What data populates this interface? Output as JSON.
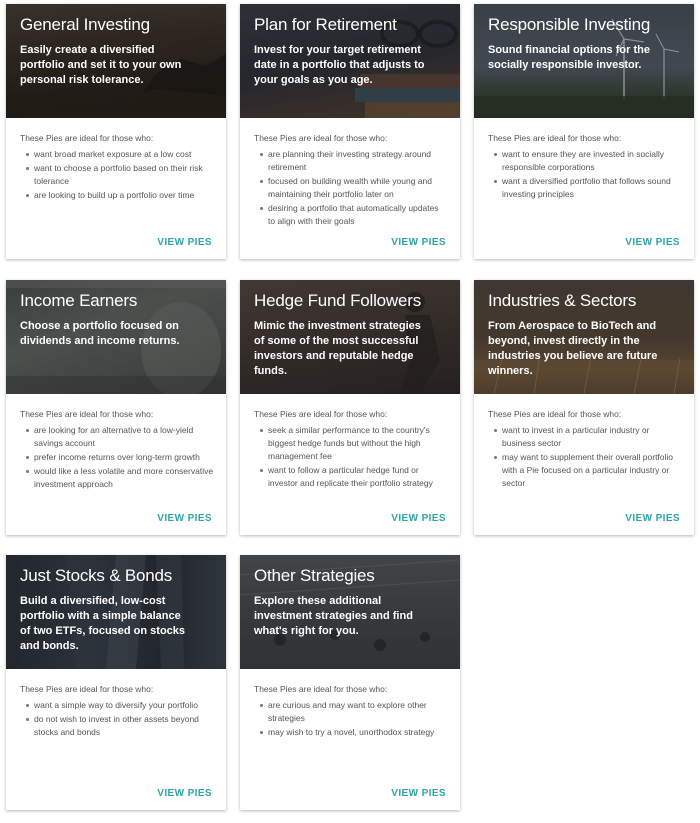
{
  "ideal_heading": "These Pies are ideal for those who:",
  "link_color": "#2ca5a6",
  "cards": [
    {
      "title": "General Investing",
      "description": "Easily create a diversified portfolio and set it to your own personal risk tolerance.",
      "bullets": [
        "want broad market exposure at a low cost",
        "want to choose a portfolio based on their risk tolerance",
        "are looking to build up a portfolio over time"
      ],
      "link": "VIEW PIES"
    },
    {
      "title": "Plan for Retirement",
      "description": "Invest for your target retirement date in a portfolio that adjusts to your goals as you age.",
      "bullets": [
        "are planning their investing strategy around retirement",
        "focused on building wealth while young and maintaining their portfolio later on",
        "desiring a portfolio that automatically updates to align with their goals"
      ],
      "link": "VIEW PIES"
    },
    {
      "title": "Responsible Investing",
      "description": "Sound financial options for the socially responsible investor.",
      "bullets": [
        "want to ensure they are invested in socially responsible corporations",
        "want a diversified portfolio that follows sound investing principles"
      ],
      "link": "VIEW PIES"
    },
    {
      "title": "Income Earners",
      "description": "Choose a portfolio focused on dividends and income returns.",
      "bullets": [
        "are looking for an alternative to a low-yield savings account",
        "prefer income returns over long-term growth",
        "would like a less volatile and more conservative investment approach"
      ],
      "link": "VIEW PIES"
    },
    {
      "title": "Hedge Fund Followers",
      "description": "Mimic the investment strategies of some of the most successful investors and reputable hedge funds.",
      "bullets": [
        "seek a similar performance to the country's biggest hedge funds but without the high management fee",
        "want to follow a particular hedge fund or investor and replicate their portfolio strategy"
      ],
      "link": "VIEW PIES"
    },
    {
      "title": "Industries & Sectors",
      "description": "From Aerospace to BioTech and beyond, invest directly in the industries you believe are future winners.",
      "bullets": [
        "want to invest in a particular industry or business sector",
        "may want to supplement their overall portfolio with a Pie focused on a particular industry or sector"
      ],
      "link": "VIEW PIES"
    },
    {
      "title": "Just Stocks & Bonds",
      "description": "Build a diversified, low-cost portfolio with a simple balance of two ETFs, focused on stocks and bonds.",
      "bullets": [
        "want a simple way to diversify your portfolio",
        "do not wish to invest in other assets beyond stocks and bonds"
      ],
      "link": "VIEW PIES"
    },
    {
      "title": "Other Strategies",
      "description": "Explore these additional investment strategies and find what's right for you.",
      "bullets": [
        "are curious and may want to explore other strategies",
        "may wish to try a novel, unorthodox strategy"
      ],
      "link": "VIEW PIES"
    }
  ]
}
